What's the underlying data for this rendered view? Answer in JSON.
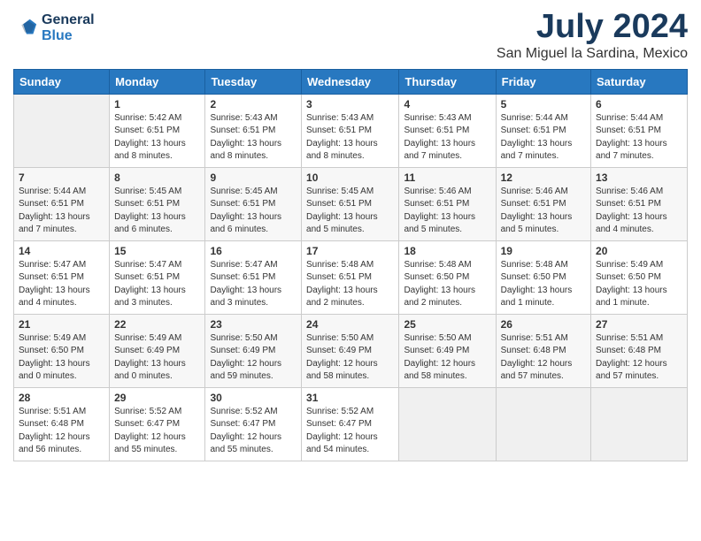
{
  "logo": {
    "line1": "General",
    "line2": "Blue"
  },
  "title": "July 2024",
  "location": "San Miguel la Sardina, Mexico",
  "weekdays": [
    "Sunday",
    "Monday",
    "Tuesday",
    "Wednesday",
    "Thursday",
    "Friday",
    "Saturday"
  ],
  "weeks": [
    [
      {
        "day": "",
        "sunrise": "",
        "sunset": "",
        "daylight": ""
      },
      {
        "day": "1",
        "sunrise": "Sunrise: 5:42 AM",
        "sunset": "Sunset: 6:51 PM",
        "daylight": "Daylight: 13 hours and 8 minutes."
      },
      {
        "day": "2",
        "sunrise": "Sunrise: 5:43 AM",
        "sunset": "Sunset: 6:51 PM",
        "daylight": "Daylight: 13 hours and 8 minutes."
      },
      {
        "day": "3",
        "sunrise": "Sunrise: 5:43 AM",
        "sunset": "Sunset: 6:51 PM",
        "daylight": "Daylight: 13 hours and 8 minutes."
      },
      {
        "day": "4",
        "sunrise": "Sunrise: 5:43 AM",
        "sunset": "Sunset: 6:51 PM",
        "daylight": "Daylight: 13 hours and 7 minutes."
      },
      {
        "day": "5",
        "sunrise": "Sunrise: 5:44 AM",
        "sunset": "Sunset: 6:51 PM",
        "daylight": "Daylight: 13 hours and 7 minutes."
      },
      {
        "day": "6",
        "sunrise": "Sunrise: 5:44 AM",
        "sunset": "Sunset: 6:51 PM",
        "daylight": "Daylight: 13 hours and 7 minutes."
      }
    ],
    [
      {
        "day": "7",
        "sunrise": "Sunrise: 5:44 AM",
        "sunset": "Sunset: 6:51 PM",
        "daylight": "Daylight: 13 hours and 7 minutes."
      },
      {
        "day": "8",
        "sunrise": "Sunrise: 5:45 AM",
        "sunset": "Sunset: 6:51 PM",
        "daylight": "Daylight: 13 hours and 6 minutes."
      },
      {
        "day": "9",
        "sunrise": "Sunrise: 5:45 AM",
        "sunset": "Sunset: 6:51 PM",
        "daylight": "Daylight: 13 hours and 6 minutes."
      },
      {
        "day": "10",
        "sunrise": "Sunrise: 5:45 AM",
        "sunset": "Sunset: 6:51 PM",
        "daylight": "Daylight: 13 hours and 5 minutes."
      },
      {
        "day": "11",
        "sunrise": "Sunrise: 5:46 AM",
        "sunset": "Sunset: 6:51 PM",
        "daylight": "Daylight: 13 hours and 5 minutes."
      },
      {
        "day": "12",
        "sunrise": "Sunrise: 5:46 AM",
        "sunset": "Sunset: 6:51 PM",
        "daylight": "Daylight: 13 hours and 5 minutes."
      },
      {
        "day": "13",
        "sunrise": "Sunrise: 5:46 AM",
        "sunset": "Sunset: 6:51 PM",
        "daylight": "Daylight: 13 hours and 4 minutes."
      }
    ],
    [
      {
        "day": "14",
        "sunrise": "Sunrise: 5:47 AM",
        "sunset": "Sunset: 6:51 PM",
        "daylight": "Daylight: 13 hours and 4 minutes."
      },
      {
        "day": "15",
        "sunrise": "Sunrise: 5:47 AM",
        "sunset": "Sunset: 6:51 PM",
        "daylight": "Daylight: 13 hours and 3 minutes."
      },
      {
        "day": "16",
        "sunrise": "Sunrise: 5:47 AM",
        "sunset": "Sunset: 6:51 PM",
        "daylight": "Daylight: 13 hours and 3 minutes."
      },
      {
        "day": "17",
        "sunrise": "Sunrise: 5:48 AM",
        "sunset": "Sunset: 6:51 PM",
        "daylight": "Daylight: 13 hours and 2 minutes."
      },
      {
        "day": "18",
        "sunrise": "Sunrise: 5:48 AM",
        "sunset": "Sunset: 6:50 PM",
        "daylight": "Daylight: 13 hours and 2 minutes."
      },
      {
        "day": "19",
        "sunrise": "Sunrise: 5:48 AM",
        "sunset": "Sunset: 6:50 PM",
        "daylight": "Daylight: 13 hours and 1 minute."
      },
      {
        "day": "20",
        "sunrise": "Sunrise: 5:49 AM",
        "sunset": "Sunset: 6:50 PM",
        "daylight": "Daylight: 13 hours and 1 minute."
      }
    ],
    [
      {
        "day": "21",
        "sunrise": "Sunrise: 5:49 AM",
        "sunset": "Sunset: 6:50 PM",
        "daylight": "Daylight: 13 hours and 0 minutes."
      },
      {
        "day": "22",
        "sunrise": "Sunrise: 5:49 AM",
        "sunset": "Sunset: 6:49 PM",
        "daylight": "Daylight: 13 hours and 0 minutes."
      },
      {
        "day": "23",
        "sunrise": "Sunrise: 5:50 AM",
        "sunset": "Sunset: 6:49 PM",
        "daylight": "Daylight: 12 hours and 59 minutes."
      },
      {
        "day": "24",
        "sunrise": "Sunrise: 5:50 AM",
        "sunset": "Sunset: 6:49 PM",
        "daylight": "Daylight: 12 hours and 58 minutes."
      },
      {
        "day": "25",
        "sunrise": "Sunrise: 5:50 AM",
        "sunset": "Sunset: 6:49 PM",
        "daylight": "Daylight: 12 hours and 58 minutes."
      },
      {
        "day": "26",
        "sunrise": "Sunrise: 5:51 AM",
        "sunset": "Sunset: 6:48 PM",
        "daylight": "Daylight: 12 hours and 57 minutes."
      },
      {
        "day": "27",
        "sunrise": "Sunrise: 5:51 AM",
        "sunset": "Sunset: 6:48 PM",
        "daylight": "Daylight: 12 hours and 57 minutes."
      }
    ],
    [
      {
        "day": "28",
        "sunrise": "Sunrise: 5:51 AM",
        "sunset": "Sunset: 6:48 PM",
        "daylight": "Daylight: 12 hours and 56 minutes."
      },
      {
        "day": "29",
        "sunrise": "Sunrise: 5:52 AM",
        "sunset": "Sunset: 6:47 PM",
        "daylight": "Daylight: 12 hours and 55 minutes."
      },
      {
        "day": "30",
        "sunrise": "Sunrise: 5:52 AM",
        "sunset": "Sunset: 6:47 PM",
        "daylight": "Daylight: 12 hours and 55 minutes."
      },
      {
        "day": "31",
        "sunrise": "Sunrise: 5:52 AM",
        "sunset": "Sunset: 6:47 PM",
        "daylight": "Daylight: 12 hours and 54 minutes."
      },
      {
        "day": "",
        "sunrise": "",
        "sunset": "",
        "daylight": ""
      },
      {
        "day": "",
        "sunrise": "",
        "sunset": "",
        "daylight": ""
      },
      {
        "day": "",
        "sunrise": "",
        "sunset": "",
        "daylight": ""
      }
    ]
  ]
}
